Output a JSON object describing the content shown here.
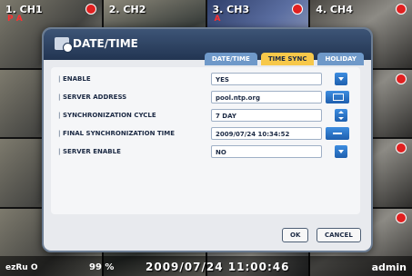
{
  "cameras": [
    {
      "label": "1. CH1",
      "motion": "P A",
      "alert": true
    },
    {
      "label": "2. CH2",
      "motion": "",
      "alert": false
    },
    {
      "label": "3. CH3",
      "motion": "A",
      "alert": true
    },
    {
      "label": "4. CH4",
      "motion": "",
      "alert": true
    },
    {
      "label": "",
      "motion": "",
      "alert": false
    },
    {
      "label": "",
      "motion": "",
      "alert": false
    },
    {
      "label": "",
      "motion": "",
      "alert": false
    },
    {
      "label": "",
      "motion": "",
      "alert": true
    },
    {
      "label": "",
      "motion": "",
      "alert": false
    },
    {
      "label": "",
      "motion": "",
      "alert": false
    },
    {
      "label": "",
      "motion": "",
      "alert": false
    },
    {
      "label": "",
      "motion": "",
      "alert": true
    },
    {
      "label": "",
      "motion": "",
      "alert": false
    },
    {
      "label": "",
      "motion": "",
      "alert": false
    },
    {
      "label": "",
      "motion": "",
      "alert": false
    },
    {
      "label": "",
      "motion": "",
      "alert": true
    }
  ],
  "status": {
    "left_text": "ezRu O",
    "hdd_text": "99 %",
    "datetime": "2009/07/24 11:00:46",
    "user": "admin"
  },
  "dialog": {
    "title": "DATE/TIME",
    "tabs": [
      {
        "label": "DATE/TIME",
        "active": false
      },
      {
        "label": "TIME SYNC",
        "active": true
      },
      {
        "label": "HOLIDAY",
        "active": false
      }
    ],
    "rows": [
      {
        "label": "ENABLE",
        "value": "YES"
      },
      {
        "label": "SERVER ADDRESS",
        "value": "pool.ntp.org"
      },
      {
        "label": "SYNCHRONIZATION CYCLE",
        "value": "7 DAY"
      },
      {
        "label": "FINAL SYNCHRONIZATION TIME",
        "value": "2009/07/24 10:34:52"
      },
      {
        "label": "SERVER ENABLE",
        "value": "NO"
      }
    ],
    "ok_label": "OK",
    "cancel_label": "CANCEL"
  },
  "colors": {
    "header": "#223552",
    "active_tab": "#f7c84a",
    "inactive_tab": "#6f99c9",
    "control_blue": "#1e5fae"
  }
}
